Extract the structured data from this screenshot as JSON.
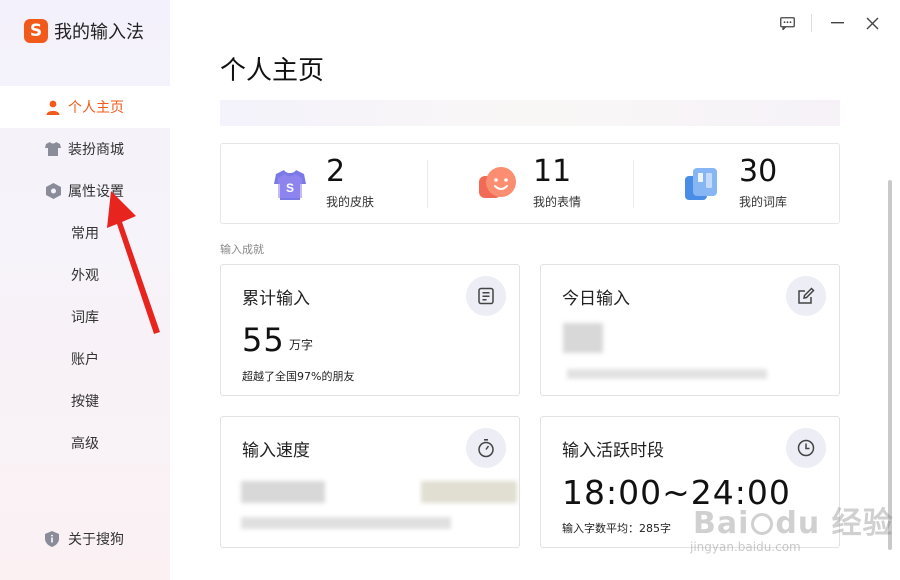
{
  "app": {
    "title": "我的输入法",
    "logo_letter": "S",
    "brand_color": "#f25a1c"
  },
  "sidebar": {
    "items": [
      {
        "label": "个人主页",
        "icon": "person-icon",
        "active": true
      },
      {
        "label": "装扮商城",
        "icon": "tshirt-icon",
        "active": false
      },
      {
        "label": "属性设置",
        "icon": "settings-hexagon-icon",
        "active": false
      }
    ],
    "subitems": [
      "常用",
      "外观",
      "词库",
      "账户",
      "按键",
      "高级"
    ],
    "about": {
      "label": "关于搜狗",
      "icon": "info-shield-icon"
    }
  },
  "window_controls": [
    "feedback-icon",
    "minimize-icon",
    "close-icon"
  ],
  "page": {
    "title": "个人主页"
  },
  "stats": [
    {
      "value": "2",
      "label": "我的皮肤",
      "icon": "skin-shirt-icon"
    },
    {
      "value": "11",
      "label": "我的表情",
      "icon": "smiley-icon"
    },
    {
      "value": "30",
      "label": "我的词库",
      "icon": "dictionary-icon"
    }
  ],
  "achievements": {
    "section_label": "输入成就",
    "total": {
      "title": "累计输入",
      "value": "55",
      "unit": "万字",
      "note": "超越了全国97%的朋友"
    },
    "today": {
      "title": "今日输入"
    },
    "speed": {
      "title": "输入速度"
    },
    "active": {
      "title": "输入活跃时段",
      "value": "18:00~24:00",
      "note": "输入字数平均：285字"
    }
  },
  "watermark": {
    "text": "Baidu经验",
    "url": "jingyan.baidu.com"
  }
}
